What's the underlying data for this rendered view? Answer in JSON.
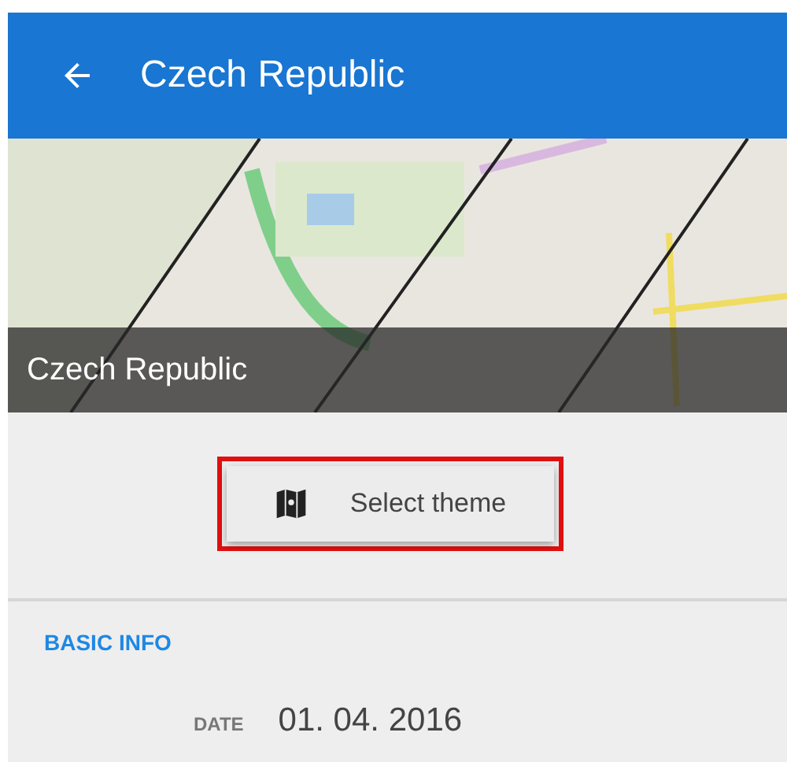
{
  "app_bar": {
    "title": "Czech Republic"
  },
  "header_image": {
    "caption": "Czech Republic"
  },
  "theme_button": {
    "label": "Select theme",
    "highlighted": true
  },
  "basic_info": {
    "heading": "BASIC INFO",
    "rows": [
      {
        "label": "DATE",
        "value": "01. 04. 2016"
      }
    ]
  }
}
